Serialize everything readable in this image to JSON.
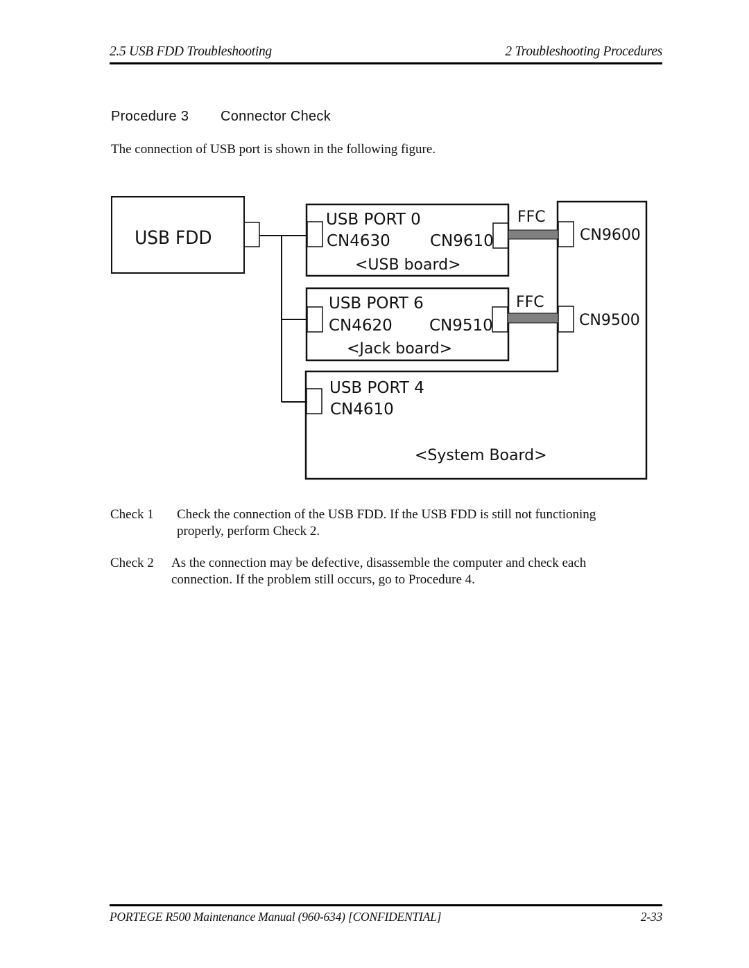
{
  "header": {
    "section": "2.5 USB FDD Troubleshooting",
    "chapter": "2  Troubleshooting Procedures"
  },
  "procedure": {
    "number": "Procedure 3",
    "title": "Connector Check",
    "intro": "The connection of USB port is shown in the following figure."
  },
  "diagram": {
    "device": {
      "label": "USB FDD"
    },
    "usb_board": {
      "port": "USB PORT 0",
      "left_connector": "CN4630",
      "right_connector": "CN9610",
      "name": "<USB board>",
      "cable": "FFC",
      "system_connector": "CN9600"
    },
    "jack_board": {
      "port": "USB PORT 6",
      "left_connector": "CN4620",
      "right_connector": "CN9510",
      "name": "<Jack board>",
      "cable": "FFC",
      "system_connector": "CN9500"
    },
    "system_board": {
      "port": "USB PORT 4",
      "connector": "CN4610",
      "name": "<System Board>"
    },
    "colors": {
      "line": "#111111",
      "ffc_cable": "#808080"
    }
  },
  "checks": [
    {
      "label": "Check 1",
      "lines": [
        "Check the connection of the USB FDD. If the USB FDD is still not functioning",
        "properly, perform Check 2."
      ]
    },
    {
      "label": "Check 2",
      "lines": [
        "As the connection may be defective, disassemble the computer and check each",
        "connection. If the problem still occurs, go to Procedure 4."
      ]
    }
  ],
  "footer": {
    "manual": "PORTEGE R500 Maintenance Manual (960-634) [CONFIDENTIAL]",
    "page": "2-33"
  }
}
